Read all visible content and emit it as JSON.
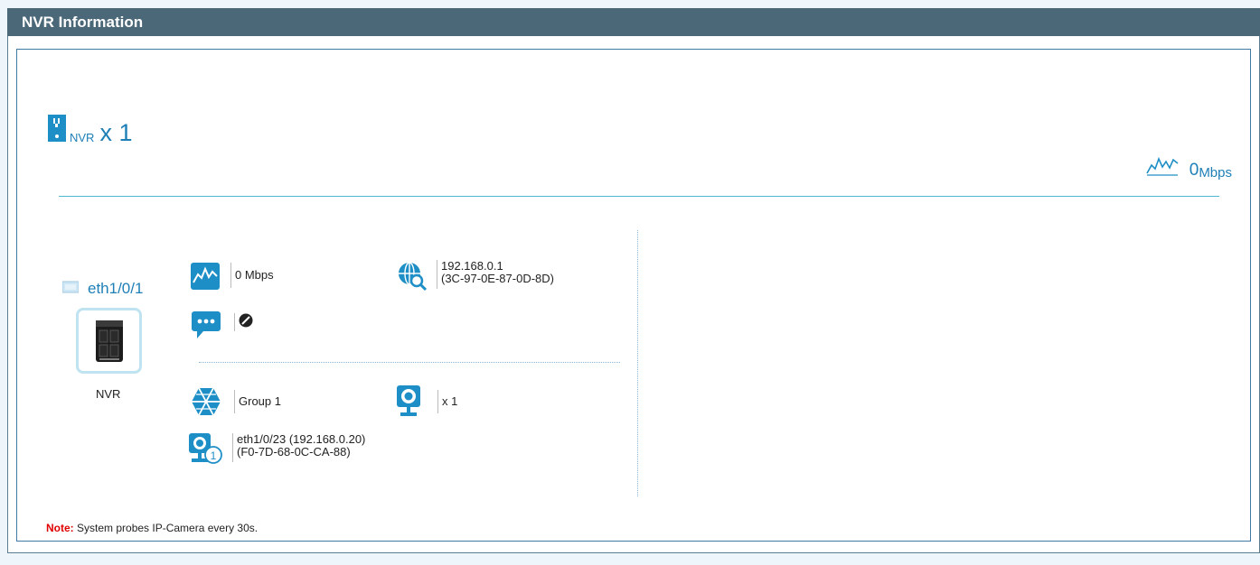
{
  "header": {
    "title": "NVR Information"
  },
  "summary": {
    "device_label": "NVR",
    "count_text": "x 1",
    "bandwidth_value": "0",
    "bandwidth_unit": "Mbps"
  },
  "device": {
    "port": "eth1/0/1",
    "name": "NVR",
    "bandwidth": "0 Mbps",
    "ip": "192.168.0.1",
    "mac": "(3C-97-0E-87-0D-8D)",
    "group": "Group 1",
    "camera_count": "x 1",
    "camera_port_ip": "eth1/0/23 (192.168.0.20)",
    "camera_mac": "(F0-7D-68-0C-CA-88)",
    "camera_badge": "1"
  },
  "note": {
    "label": "Note:",
    "text": " System probes IP-Camera every 30s."
  },
  "icons": {
    "nvr": "nvr-icon",
    "bandwidth": "bandwidth-wave-icon",
    "ip": "globe-search-icon",
    "status": "speech-bubble-icon",
    "disabled": "disabled-icon",
    "group": "group-icon",
    "camera": "camera-icon",
    "camera-numbered": "camera-badge-icon",
    "port": "port-icon"
  },
  "colors": {
    "header_bg": "#4b6879",
    "accent": "#1e7fb7",
    "note": "#e00000"
  }
}
